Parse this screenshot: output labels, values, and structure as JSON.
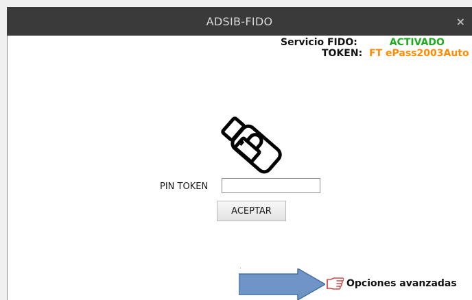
{
  "window": {
    "title": "ADSIB-FIDO",
    "close_label": "×"
  },
  "status": {
    "service_label": "Servicio FIDO:",
    "service_value": "ACTIVADO",
    "token_label": "TOKEN:",
    "token_value": "FT ePass2003Auto"
  },
  "form": {
    "pin_label": "PIN TOKEN",
    "pin_value": "",
    "accept_label": "ACEPTAR"
  },
  "footer": {
    "advanced_label": "Opciones avanzadas"
  },
  "icons": {
    "usb": "usb-lock-icon",
    "hand": "pointing-hand-icon",
    "arrow": "right-arrow-icon"
  },
  "colors": {
    "activated": "#1faa1f",
    "token": "#ff8a00",
    "titlebar": "#3a3a3a",
    "arrow_fill": "#6f95c7",
    "hand": "#d64545"
  }
}
